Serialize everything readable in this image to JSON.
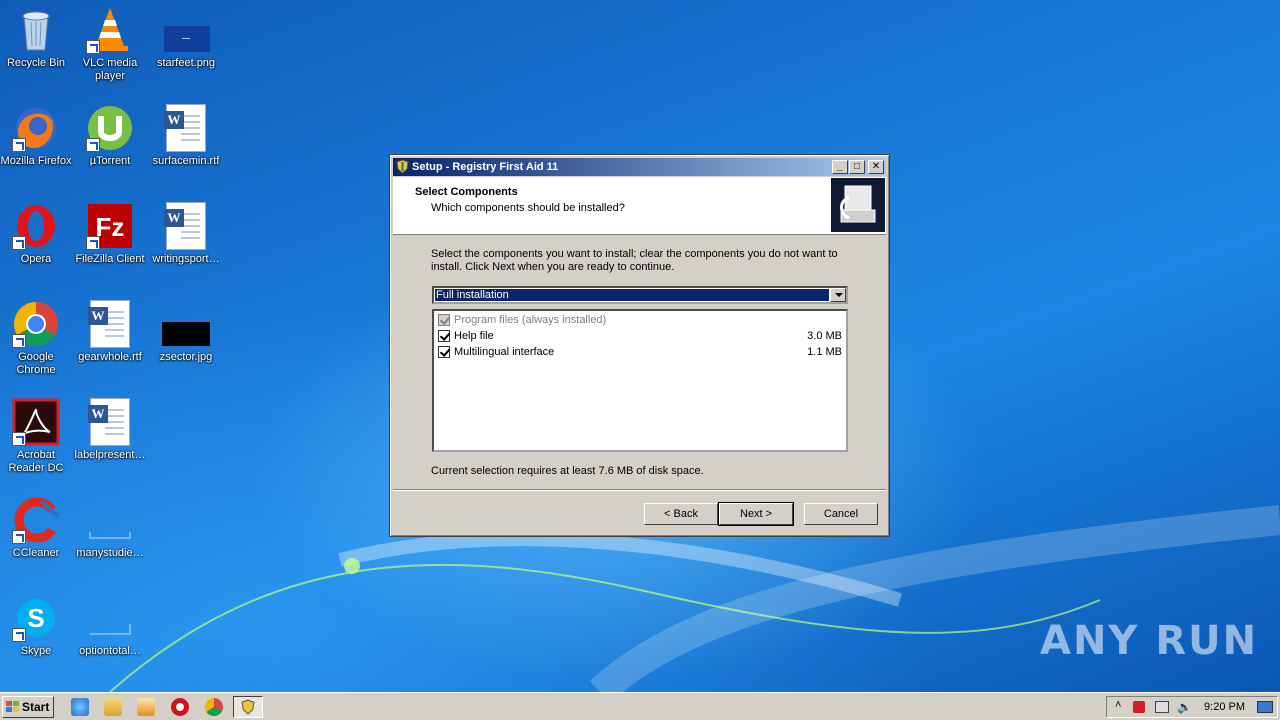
{
  "desktop": {
    "icons": {
      "recycle_bin": "Recycle Bin",
      "vlc": "VLC media player",
      "starfeet": "starfeet.png",
      "firefox": "Mozilla Firefox",
      "utorrent": "µTorrent",
      "surfacemin": "surfacemin.rtf",
      "opera": "Opera",
      "filezilla": "FileZilla Client",
      "writingsport": "writingsport…",
      "chrome": "Google Chrome",
      "gearwhole": "gearwhole.rtf",
      "zsector": "zsector.jpg",
      "acrobat": "Acrobat Reader DC",
      "labelpresent": "labelpresent…",
      "ccleaner": "CCleaner",
      "manystudie": "manystudie…",
      "skype": "Skype",
      "optiontotal": "optiontotal…"
    },
    "watermark": "ANY RUN"
  },
  "dialog": {
    "title": "Setup - Registry First Aid 11",
    "header_title": "Select Components",
    "header_subtitle": "Which components should be installed?",
    "instructions": "Select the components you want to install; clear the components you do not want to install. Click Next when you are ready to continue.",
    "install_type": "Full installation",
    "components": [
      {
        "label": "Program files (always installed)",
        "size": "",
        "checked": true,
        "disabled": true
      },
      {
        "label": "Help file",
        "size": "3.0 MB",
        "checked": true,
        "disabled": false
      },
      {
        "label": "Multilingual interface",
        "size": "1.1 MB",
        "checked": true,
        "disabled": false
      }
    ],
    "requirement": "Current selection requires at least 7.6 MB of disk space.",
    "buttons": {
      "back": "< Back",
      "next": "Next >",
      "cancel": "Cancel"
    },
    "window_buttons": {
      "minimize": "_",
      "maximize": "□",
      "close": "✕"
    }
  },
  "taskbar": {
    "start_label": "Start",
    "clock": "9:20 PM"
  },
  "colors": {
    "titlebar_start": "#0a246a",
    "titlebar_end": "#a6caf0",
    "selection": "#0a246a",
    "dialog_face": "#d4d0c8"
  }
}
